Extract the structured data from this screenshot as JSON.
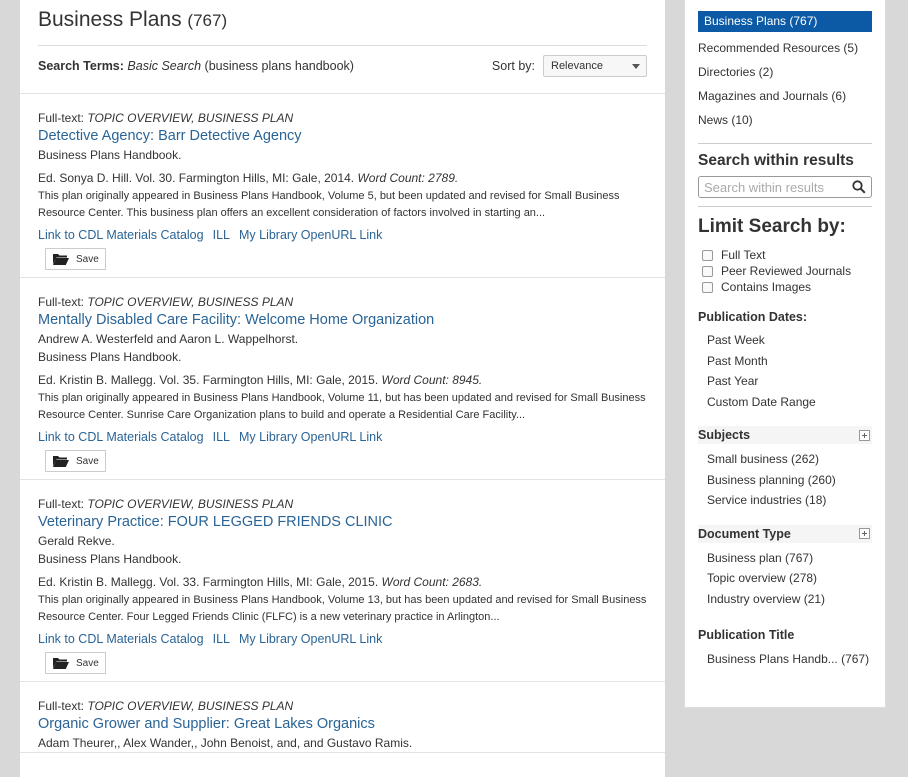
{
  "header": {
    "title": "Business Plans",
    "count": "(767)",
    "search_terms_label": "Search Terms:",
    "search_kind": "Basic Search",
    "search_query": "(business plans handbook)",
    "sort_label": "Sort by:",
    "sort_value": "Relevance"
  },
  "results": [
    {
      "type_prefix": "Full-text:",
      "type": "TOPIC OVERVIEW, BUSINESS PLAN",
      "title": "Detective Agency: Barr Detective Agency",
      "lines": [
        "Business Plans Handbook."
      ],
      "citation": "Ed. Sonya D. Hill. Vol. 30.  Farmington Hills, MI: Gale, 2014.",
      "word_count": "Word Count: 2789.",
      "abstract": "This plan originally appeared in Business Plans Handbook, Volume 5, but been updated and revised for Small Business Resource Center. This business plan offers an excellent consideration of factors involved in starting an...",
      "links": [
        "Link to CDL Materials Catalog",
        "ILL",
        "My Library OpenURL Link"
      ],
      "save_label": "Save"
    },
    {
      "type_prefix": "Full-text:",
      "type": "TOPIC OVERVIEW, BUSINESS PLAN",
      "title": "Mentally Disabled Care Facility: Welcome Home Organization",
      "lines": [
        "Andrew A. Westerfeld and Aaron L. Wappelhorst.",
        "Business Plans Handbook."
      ],
      "citation": "Ed. Kristin B. Mallegg. Vol. 35.  Farmington Hills, MI: Gale, 2015.",
      "word_count": "Word Count: 8945.",
      "abstract": "This plan originally appeared in Business Plans Handbook, Volume 11, but has been updated and revised for Small Business Resource Center. Sunrise Care Organization plans to build and operate a Residential Care Facility...",
      "links": [
        "Link to CDL Materials Catalog",
        "ILL",
        "My Library OpenURL Link"
      ],
      "save_label": "Save"
    },
    {
      "type_prefix": "Full-text:",
      "type": "TOPIC OVERVIEW, BUSINESS PLAN",
      "title": "Veterinary Practice: FOUR LEGGED FRIENDS CLINIC",
      "lines": [
        "Gerald Rekve.",
        "Business Plans Handbook."
      ],
      "citation": "Ed. Kristin B. Mallegg. Vol. 33.  Farmington Hills, MI: Gale, 2015.",
      "word_count": "Word Count: 2683.",
      "abstract": "This plan originally appeared in Business Plans Handbook, Volume 13, but has been updated and revised for Small Business Resource Center. Four Legged Friends Clinic (FLFC) is a new veterinary practice in Arlington...",
      "links": [
        "Link to CDL Materials Catalog",
        "ILL",
        "My Library OpenURL Link"
      ],
      "save_label": "Save"
    },
    {
      "type_prefix": "Full-text:",
      "type": "TOPIC OVERVIEW, BUSINESS PLAN",
      "title": "Organic Grower and Supplier: Great Lakes Organics",
      "lines": [
        "Adam Theurer,, Alex Wander,, John Benoist, and, and Gustavo Ramis."
      ]
    }
  ],
  "sidebar": {
    "active_category": "Business Plans (767)",
    "categories": [
      "Recommended Resources (5)",
      "Directories (2)",
      "Magazines and Journals (6)",
      "News (10)"
    ],
    "search_within_heading": "Search within results",
    "search_within_placeholder": "Search within results",
    "limit_heading": "Limit Search by:",
    "checkboxes": [
      "Full Text",
      "Peer Reviewed Journals",
      "Contains Images"
    ],
    "pub_dates_heading": "Publication Dates:",
    "pub_dates": [
      "Past Week",
      "Past Month",
      "Past Year",
      "Custom Date Range"
    ],
    "subjects_heading": "Subjects",
    "subjects": [
      "Small business (262)",
      "Business planning (260)",
      "Service industries (18)"
    ],
    "doc_type_heading": "Document Type",
    "doc_types": [
      "Business plan (767)",
      "Topic overview (278)",
      "Industry overview (21)"
    ],
    "pub_title_heading": "Publication Title",
    "pub_titles": [
      "Business Plans Handb... (767)"
    ]
  },
  "colors": {
    "link": "#2a6496",
    "active": "#0c5aa6"
  }
}
